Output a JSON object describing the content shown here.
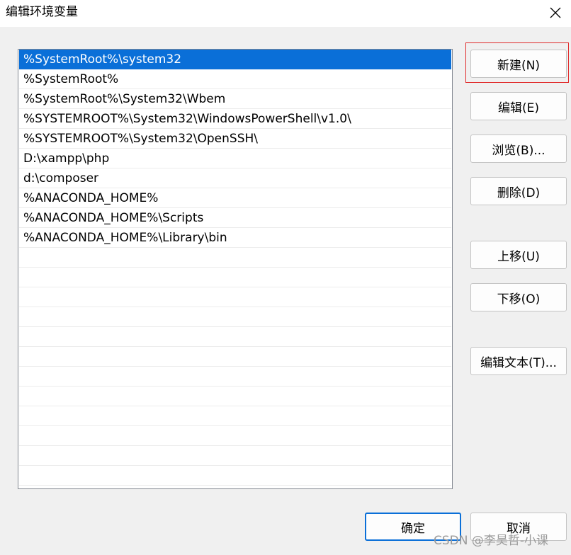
{
  "window": {
    "title": "编辑环境变量",
    "close_icon": "close-icon"
  },
  "path_list": {
    "selected_index": 0,
    "items": [
      "%SystemRoot%\\system32",
      "%SystemRoot%",
      "%SystemRoot%\\System32\\Wbem",
      "%SYSTEMROOT%\\System32\\WindowsPowerShell\\v1.0\\",
      "%SYSTEMROOT%\\System32\\OpenSSH\\",
      "D:\\xampp\\php",
      "d:\\composer",
      "%ANACONDA_HOME%",
      "%ANACONDA_HOME%\\Scripts",
      "%ANACONDA_HOME%\\Library\\bin"
    ]
  },
  "buttons": {
    "new": "新建(N)",
    "edit": "编辑(E)",
    "browse": "浏览(B)...",
    "delete": "删除(D)",
    "move_up": "上移(U)",
    "move_down": "下移(O)",
    "edit_text": "编辑文本(T)...",
    "ok": "确定",
    "cancel": "取消"
  },
  "watermark": "CSDN @李昊哲-小课",
  "colors": {
    "selection": "#0a6fd8",
    "annotation_box": "#e02a2a"
  }
}
